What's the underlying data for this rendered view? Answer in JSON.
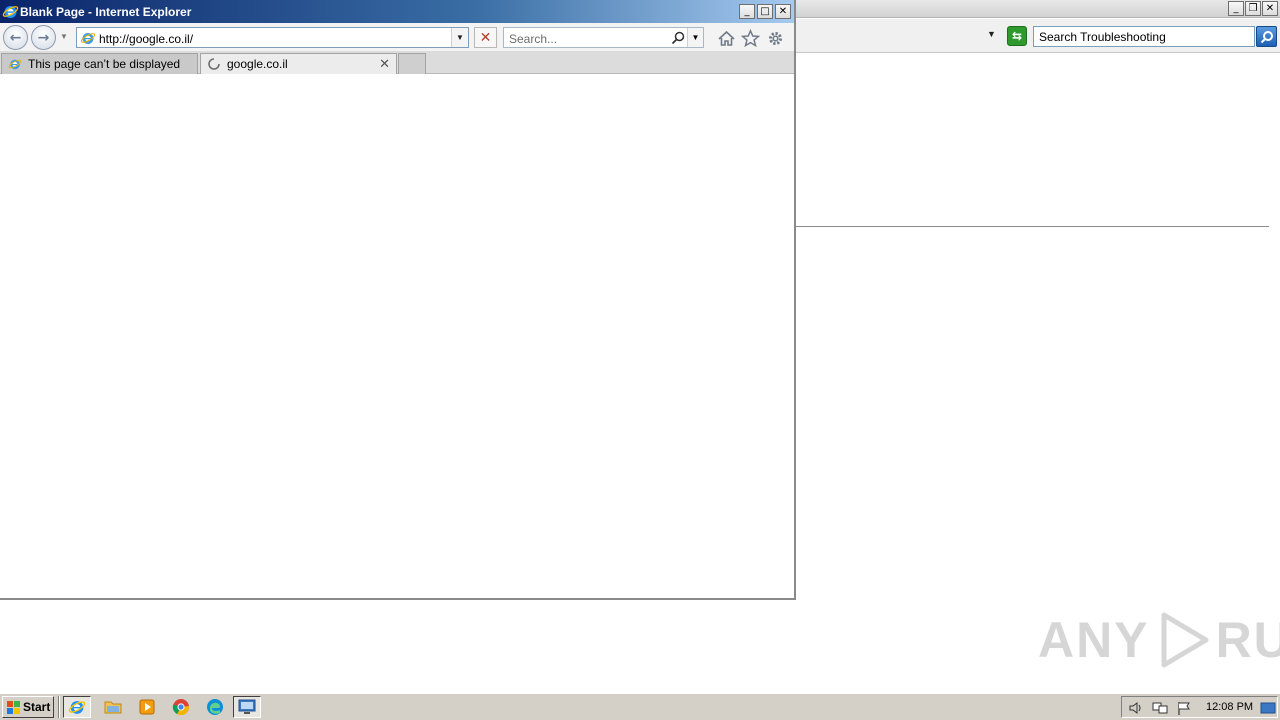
{
  "background_window": {
    "search_value": "Search Troubleshooting",
    "caption_buttons": [
      "minimize",
      "restore",
      "close"
    ]
  },
  "ie_window": {
    "title": "Blank Page - Internet Explorer",
    "address_value": "http://google.co.il/",
    "search_placeholder": "Search...",
    "tabs": [
      {
        "label": "This page can’t be displayed",
        "icon": "ie-page-icon",
        "active": false
      },
      {
        "label": "google.co.il",
        "icon": "loading-spinner-icon",
        "active": true
      }
    ],
    "toolbar_icons": [
      "home-icon",
      "favorites-star-icon",
      "tools-gear-icon"
    ]
  },
  "watermark": {
    "left_text": "ANY",
    "right_text": "RUN"
  },
  "taskbar": {
    "start_label": "Start",
    "apps": [
      "internet-explorer-icon",
      "file-explorer-icon",
      "media-player-icon",
      "chrome-icon",
      "edge-icon",
      "remote-desktop-icon"
    ],
    "clock": "12:08 PM"
  },
  "colors": {
    "ie_title_gradient_start": "#0a246a",
    "ie_title_gradient_end": "#a6caf0",
    "taskbar_bg": "#d4d0c8",
    "watermark": "#d6d6d6"
  }
}
